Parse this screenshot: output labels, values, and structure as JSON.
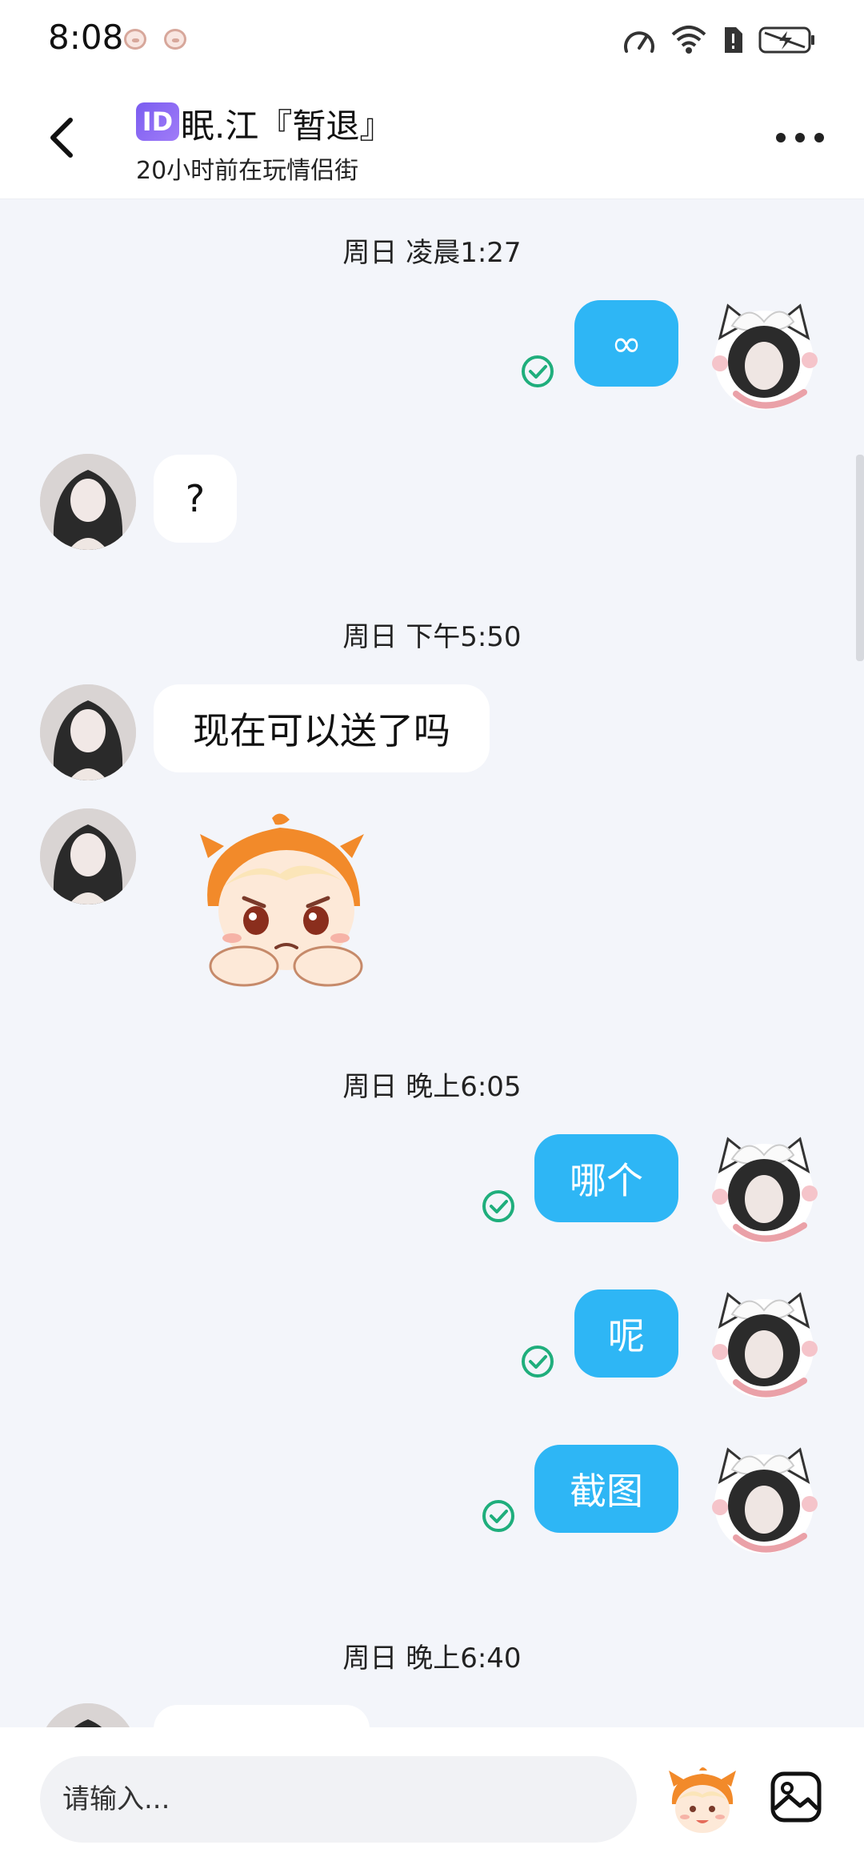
{
  "status_bar": {
    "time": "8:08"
  },
  "header": {
    "id_badge": "ID",
    "title": "眠.江『暂退』",
    "subtitle": "20小时前在玩情侣街"
  },
  "messages": {
    "ts1": "周日 凌晨1:27",
    "ts2": "周日 下午5:50",
    "ts3": "周日 晚上6:05",
    "ts4": "周日 晚上6:40",
    "m1": "∞",
    "m2": "?",
    "m3": "现在可以送了吗",
    "m4": "哪个",
    "m5": "呢",
    "m6": "截图"
  },
  "input": {
    "placeholder": "请输入..."
  },
  "colors": {
    "outgoing_bubble": "#2eb6f5",
    "read_check": "#1fae7c",
    "id_badge": "#7a5cf0"
  }
}
